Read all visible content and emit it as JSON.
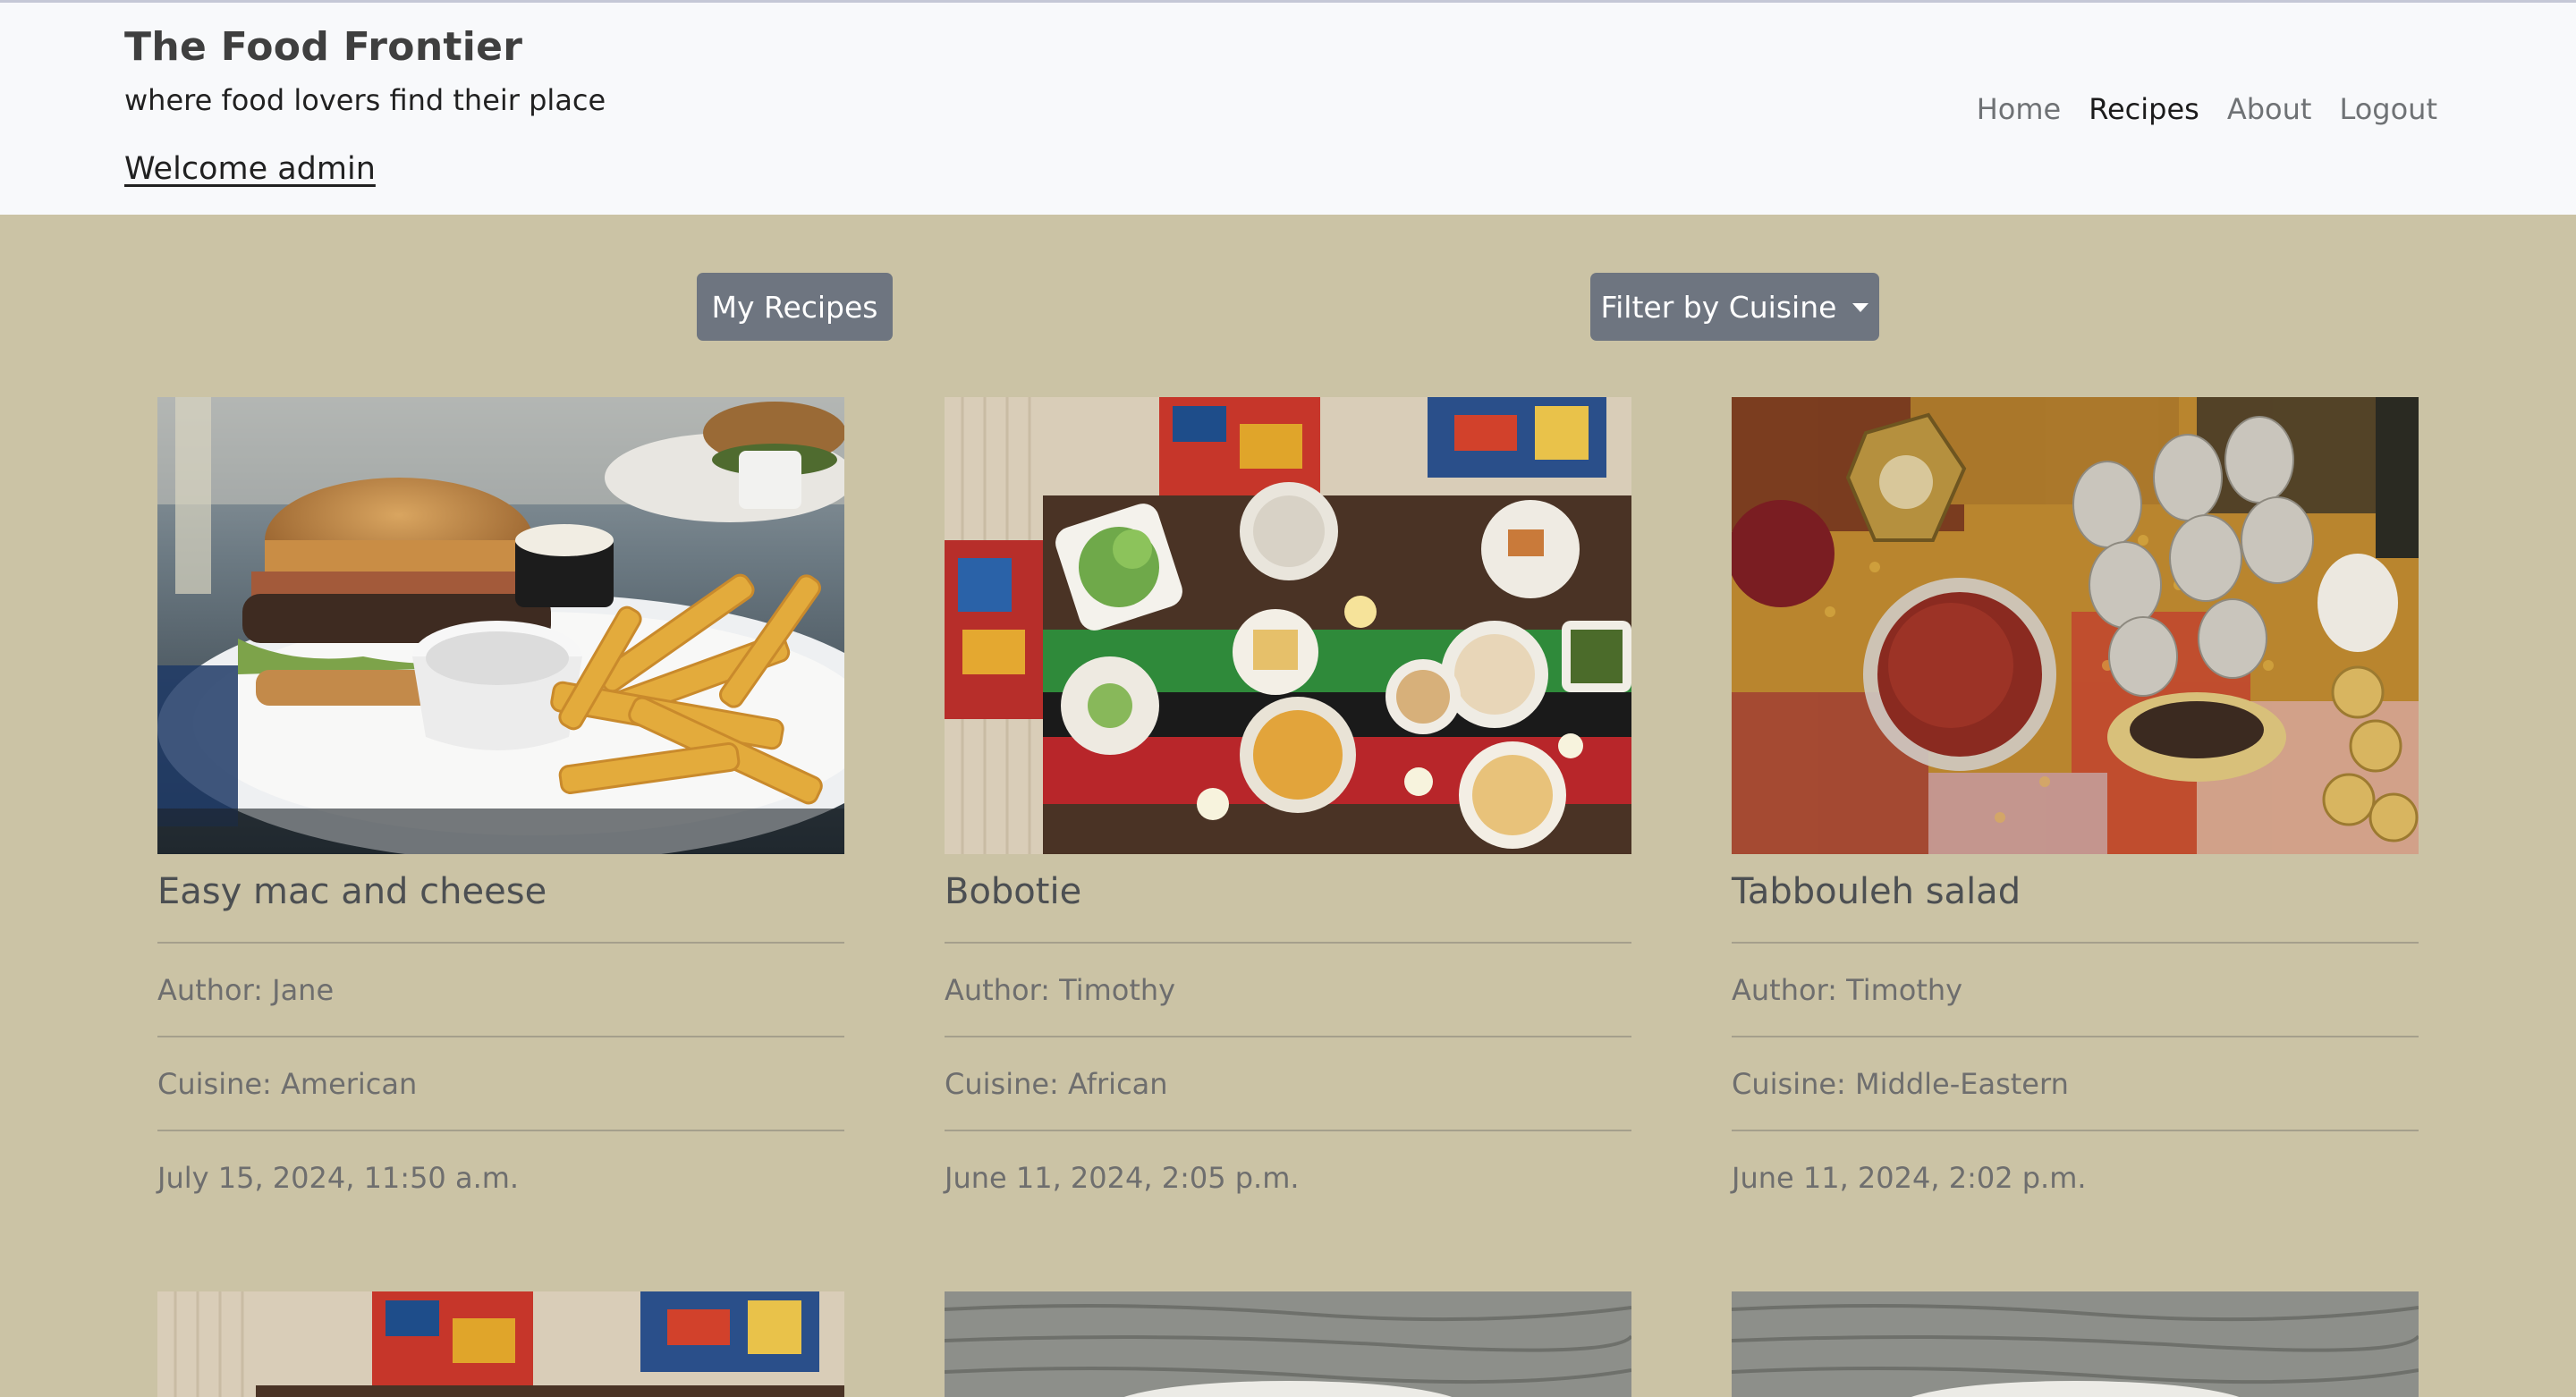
{
  "site": {
    "title": "The Food Frontier",
    "tagline": "where food lovers find their place",
    "welcome": "Welcome admin"
  },
  "nav": {
    "home": "Home",
    "recipes": "Recipes",
    "about": "About",
    "logout": "Logout",
    "active": "Recipes"
  },
  "toolbar": {
    "my_recipes": "My Recipes",
    "filter_cuisine": "Filter by Cuisine"
  },
  "colors": {
    "page_bg": "#cbc3a5",
    "header_bg": "#f8f9fb",
    "button_bg": "#6e7580"
  },
  "recipes": [
    {
      "title": "Easy mac and cheese",
      "author": "Author: Jane",
      "cuisine": "Cuisine: American",
      "date": "July 15, 2024, 11:50 a.m.",
      "image": "burger-and-fries-photo"
    },
    {
      "title": "Bobotie",
      "author": "Author: Timothy",
      "cuisine": "Cuisine: African",
      "date": "June 11, 2024, 2:05 p.m.",
      "image": "african-table-spread-photo"
    },
    {
      "title": "Tabbouleh salad",
      "author": "Author: Timothy",
      "cuisine": "Cuisine: Middle-Eastern",
      "date": "June 11, 2024, 2:02 p.m.",
      "image": "spices-and-eggs-photo"
    }
  ],
  "more_recipes": [
    {
      "image": "african-table-spread-photo"
    },
    {
      "image": "wooden-table-bowl-photo"
    },
    {
      "image": "wooden-table-bowl-photo"
    }
  ]
}
